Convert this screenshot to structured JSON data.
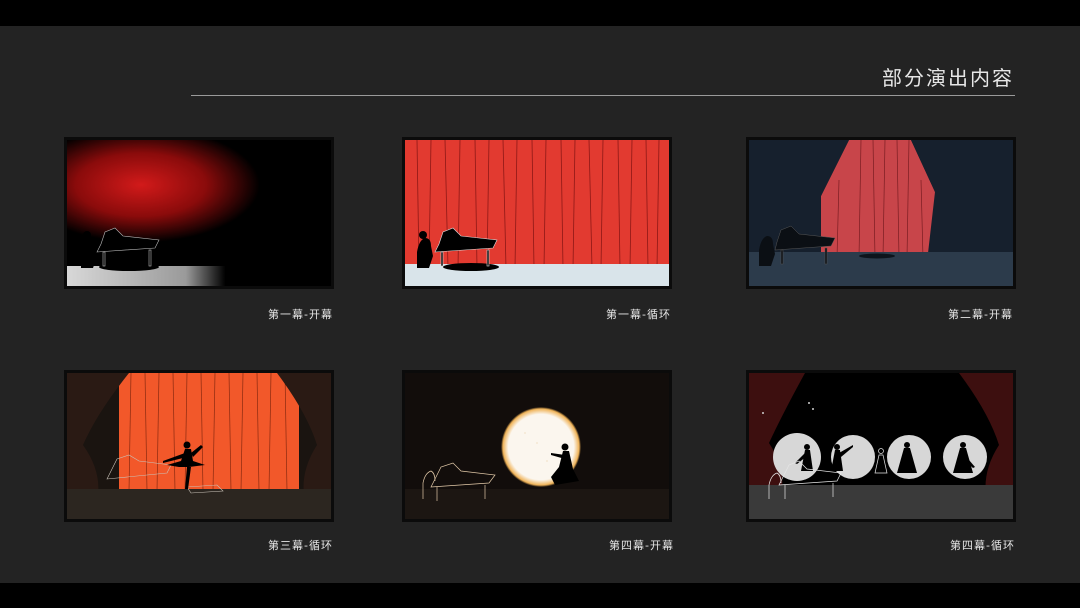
{
  "slide": {
    "title": "部分演出内容"
  },
  "scenes": [
    {
      "caption": "第一幕-开幕"
    },
    {
      "caption": "第一幕-循环"
    },
    {
      "caption": "第二幕-开幕"
    },
    {
      "caption": "第三幕-循环"
    },
    {
      "caption": "第四幕-开幕"
    },
    {
      "caption": "第四幕-循环"
    }
  ]
}
